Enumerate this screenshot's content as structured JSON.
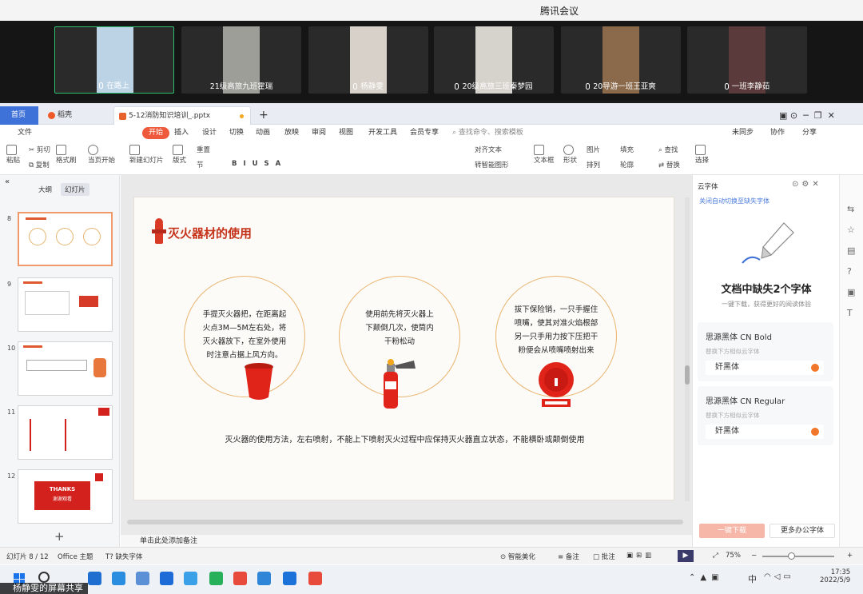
{
  "app_title": "腾讯会议",
  "participants": [
    {
      "name": "在路上",
      "bg": "#bcd3e6",
      "mic": true
    },
    {
      "name": "21级高旅九班霍瑞",
      "bg": "#9e9e98",
      "mic": false
    },
    {
      "name": "杨静雯",
      "bg": "#d8d1c9",
      "mic": true
    },
    {
      "name": "20级高旅三班秦梦园",
      "bg": "#d6d2cc",
      "mic": true
    },
    {
      "name": "20导游一班王亚爽",
      "bg": "#8a6a4a",
      "mic": true
    },
    {
      "name": "一班李静茹",
      "bg": "#5a3a3a",
      "mic": true
    }
  ],
  "tabs": {
    "home": "首页",
    "daoke": "稻壳",
    "doc": "5-12消防知识培训_.pptx"
  },
  "menu": [
    "文件",
    "开始",
    "插入",
    "设计",
    "切换",
    "动画",
    "放映",
    "审阅",
    "视图",
    "开发工具",
    "会员专享"
  ],
  "menu_search": "查找命令、搜索模板",
  "menu_right": [
    "未同步",
    "协作",
    "分享"
  ],
  "toolbar": {
    "paste": "粘贴",
    "cut": "剪切",
    "copy": "复制",
    "format": "格式刷",
    "play": "当页开始",
    "new_slide": "新建幻灯片",
    "layout": "版式",
    "section": "节",
    "reset": "重置",
    "text_dir": "对齐文本",
    "smartart": "转智能图形",
    "textbox": "文本框",
    "shape": "形状",
    "arrange": "排列",
    "picture": "图片",
    "fill": "填充",
    "outline": "轮廓",
    "find": "查找",
    "replace": "替换",
    "select": "选择"
  },
  "left_panel": {
    "tab_outline": "大纲",
    "tab_slides": "幻灯片",
    "slide_numbers": [
      "8",
      "9",
      "10",
      "11",
      "12"
    ],
    "thanks": "THANKS",
    "thanks_sub": "谢谢观看",
    "add": "+"
  },
  "slide": {
    "title": "灭火器材的使用",
    "circle1": [
      "手提灭火器把，在距离起",
      "火点3M—5M左右处，将",
      "灭火器放下，在室外使用",
      "时注意占据上风方向。"
    ],
    "circle2": [
      "使用前先将灭火器上",
      "下颠倒几次，使筒内",
      "干粉松动"
    ],
    "circle3": [
      "拔下保险销，一只手握住",
      "喷嘴，使其对准火焰根部",
      "另一只手用力按下压把干",
      "粉便会从喷嘴喷射出来"
    ],
    "caption": "灭火器的使用方法，左右喷射，不能上下喷射灭火过程中应保持灭火器直立状态，不能横卧或颠倒使用"
  },
  "notes": "单击此处添加备注",
  "right_panel": {
    "header": "云字体",
    "link": "关闭自动切换至缺失字体",
    "headline": "文档中缺失2个字体",
    "sub": "一键下载，获得更好的阅读体验",
    "fonts": [
      {
        "name": "思源黑体 CN Bold",
        "hint": "替换下方相似云字体",
        "sub": "奸黑体"
      },
      {
        "name": "思源黑体 CN Regular",
        "hint": "替换下方相似云字体",
        "sub": "奸黑体"
      }
    ],
    "download": "一键下载",
    "more": "更多办公字体"
  },
  "status": {
    "slide": "幻灯片 8 / 12",
    "theme": "Office 主题",
    "missing": "缺失字体",
    "beautify": "智能美化",
    "notes": "备注",
    "comment": "批注",
    "zoom": "75%"
  },
  "taskbar": {
    "time": "17:35",
    "date": "2022/5/9",
    "lang": "中"
  },
  "share_label": "杨静雯的屏幕共享"
}
